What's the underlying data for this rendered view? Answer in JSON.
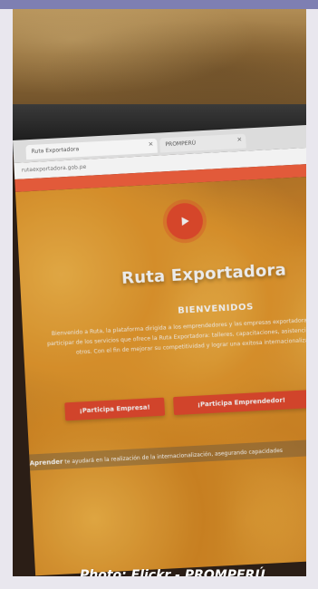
{
  "browser": {
    "tab1": "Ruta Exportadora",
    "tab2": "PROMPERÚ",
    "address": "rutaexportadora.gob.pe"
  },
  "page": {
    "title": "Ruta Exportadora",
    "welcome": "BIENVENIDOS",
    "description": "Bienvenido a Ruta, la plataforma dirigida a los emprendedores y las empresas exportadoras que deseen participar de los servicios que ofrece la Ruta Exportadora: talleres, capacitaciones, asistencia técnica, entre otros. Con el fin de mejorar su competitividad y lograr una exitosa internacionalización.",
    "cta_business": "¡Participa Empresa!",
    "cta_entrepreneur": "¡Participa Emprendedor!",
    "bottom_lead": "Aprender",
    "bottom_text": "te ayudará en la realización de la internacionalización, asegurando capacidades"
  },
  "credit": "Photo: Flickr - PROMPERÚ",
  "colors": {
    "topbar": "#7e7fb2",
    "accent": "#e34a2f"
  },
  "icons": {
    "play": "play-icon"
  }
}
